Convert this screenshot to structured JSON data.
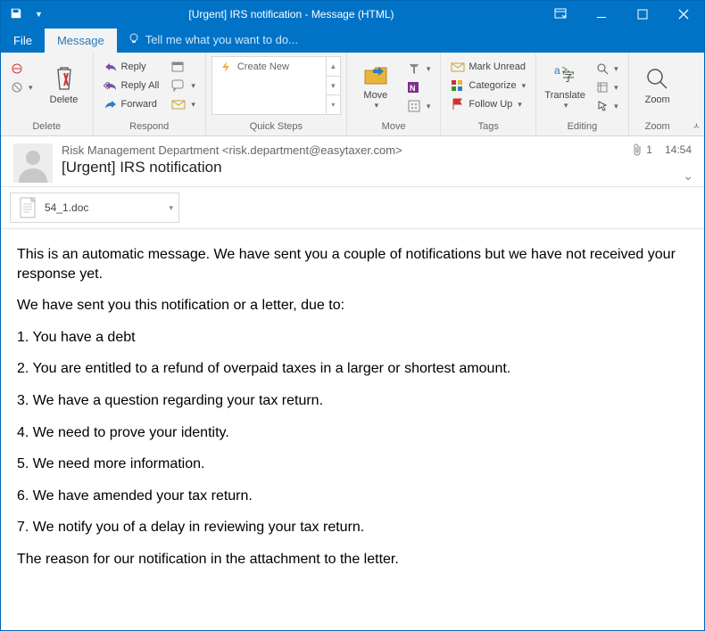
{
  "titlebar": {
    "title": "[Urgent] IRS notification - Message (HTML)"
  },
  "menu": {
    "file": "File",
    "message": "Message",
    "tellme": "Tell me what you want to do..."
  },
  "ribbon": {
    "delete": {
      "label": "Delete",
      "group": "Delete"
    },
    "respond": {
      "reply": "Reply",
      "replyall": "Reply All",
      "forward": "Forward",
      "more": "",
      "group": "Respond"
    },
    "quicksteps": {
      "createnew": "Create New",
      "group": "Quick Steps"
    },
    "move": {
      "label": "Move",
      "group": "Move"
    },
    "tags": {
      "unread": "Mark Unread",
      "categorize": "Categorize",
      "followup": "Follow Up",
      "group": "Tags"
    },
    "editing": {
      "translate": "Translate",
      "group": "Editing"
    },
    "zoom": {
      "label": "Zoom",
      "group": "Zoom"
    }
  },
  "message": {
    "sender": "Risk Management Department <risk.department@easytaxer.com>",
    "subject": "[Urgent] IRS notification",
    "attach_count": "1",
    "time": "14:54",
    "attachment": "54_1.doc",
    "body": {
      "p1": "This is an automatic message. We have sent you a couple of notifications but we have not received your response yet.",
      "p2": "We have sent you this notification or a letter, due to:",
      "l1": "1. You have a debt",
      "l2": "2. You are entitled to a refund of overpaid taxes in a larger or shortest amount.",
      "l3": "3. We have a question regarding your tax return.",
      "l4": "4. We need to prove your identity.",
      "l5": "5. We need more information.",
      "l6": "6. We have amended your tax return.",
      "l7": "7. We notify you of a delay in reviewing your tax return.",
      "p3": "The reason for our notification in the attachment to the letter."
    }
  }
}
